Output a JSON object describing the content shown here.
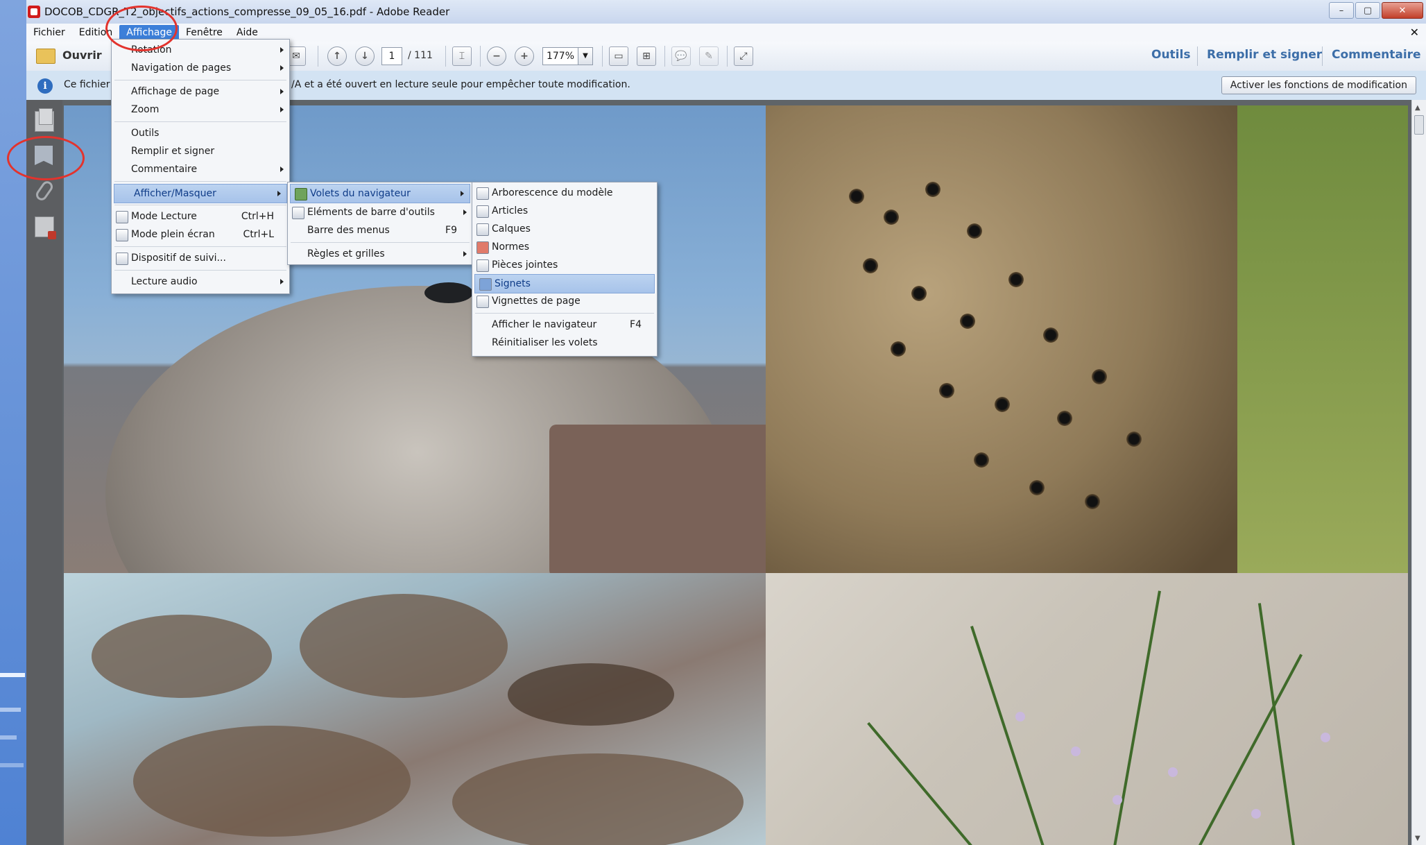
{
  "window": {
    "title": "DOCOB_CDGR_T2_objectifs_actions_compresse_09_05_16.pdf - Adobe Reader",
    "controls": {
      "minimize": "–",
      "maximize": "▢",
      "close": "✕"
    }
  },
  "menubar": {
    "items": [
      "Fichier",
      "Edition",
      "Affichage",
      "Fenêtre",
      "Aide"
    ],
    "active": "Affichage",
    "close_glyph": "✕"
  },
  "toolbar": {
    "open_label": "Ouvrir",
    "page_current": "1",
    "page_total": "/ 111",
    "zoom": "177%",
    "right_links": [
      "Outils",
      "Remplir et signer",
      "Commentaire"
    ]
  },
  "infobar": {
    "text_left": "Ce fichier",
    "text_right": "/A et a été ouvert en lecture seule pour empêcher toute modification.",
    "button": "Activer les fonctions de modification"
  },
  "menu_affichage": {
    "items": [
      {
        "label": "Rotation",
        "submenu": true
      },
      {
        "label": "Navigation de pages",
        "submenu": true
      },
      {
        "label": "Affichage de page",
        "submenu": true
      },
      {
        "label": "Zoom",
        "submenu": true
      },
      {
        "label": "Outils"
      },
      {
        "label": "Remplir et signer"
      },
      {
        "label": "Commentaire",
        "submenu": true
      },
      {
        "label": "Afficher/Masquer",
        "submenu": true,
        "highlighted": true
      },
      {
        "label": "Mode Lecture",
        "shortcut": "Ctrl+H"
      },
      {
        "label": "Mode plein écran",
        "shortcut": "Ctrl+L"
      },
      {
        "label": "Dispositif de suivi..."
      },
      {
        "label": "Lecture audio",
        "submenu": true
      }
    ]
  },
  "menu_afficher_masquer": {
    "items": [
      {
        "label": "Volets du navigateur",
        "submenu": true,
        "highlighted": true
      },
      {
        "label": "Eléments de barre d'outils",
        "submenu": true
      },
      {
        "label": "Barre des menus",
        "shortcut": "F9"
      },
      {
        "label": "Règles et grilles",
        "submenu": true
      }
    ]
  },
  "menu_volets": {
    "items": [
      {
        "label": "Arborescence du modèle"
      },
      {
        "label": "Articles"
      },
      {
        "label": "Calques"
      },
      {
        "label": "Normes"
      },
      {
        "label": "Pièces jointes"
      },
      {
        "label": "Signets",
        "highlighted": true
      },
      {
        "label": "Vignettes de page"
      },
      {
        "label": "Afficher le navigateur",
        "shortcut": "F4"
      },
      {
        "label": "Réinitialiser les volets"
      }
    ]
  },
  "colors": {
    "accent": "#3c7fd9",
    "annotation": "#e3332d",
    "link": "#3c6ea8"
  }
}
